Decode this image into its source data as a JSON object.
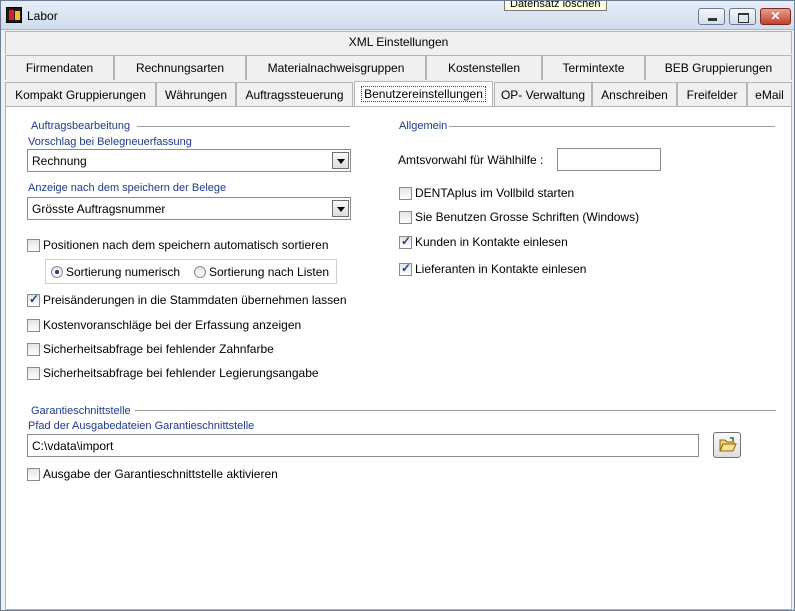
{
  "window": {
    "title": "Labor",
    "tooltip": "Datensatz löschen"
  },
  "tabs": {
    "row0": [
      "XML Einstellungen"
    ],
    "row1": [
      "Firmendaten",
      "Rechnungsarten",
      "Materialnachweisgruppen",
      "Kostenstellen",
      "Termintexte",
      "BEB Gruppierungen"
    ],
    "row2": [
      "Kompakt Gruppierungen",
      "Währungen",
      "Auftragssteuerung",
      "Benutzereinstellungen",
      "OP- Verwaltung",
      "Anschreiben",
      "Freifelder",
      "eMail"
    ],
    "active": "Benutzereinstellungen"
  },
  "auftragsbearbeitung": {
    "group_title": "Auftragsbearbeitung",
    "vorschlag_label": "Vorschlag bei Belegneuerfassung",
    "vorschlag_value": "Rechnung",
    "anzeige_label": "Anzeige nach dem speichern der Belege",
    "anzeige_value": "Grösste Auftragsnummer",
    "sort_auto": {
      "label": "Positionen nach dem speichern automatisch sortieren",
      "checked": false
    },
    "radio_numerisch": {
      "label": "Sortierung numerisch",
      "selected": true
    },
    "radio_listen": {
      "label": "Sortierung nach Listen",
      "selected": false
    },
    "preis": {
      "label": "Preisänderungen in die Stammdaten übernehmen lassen",
      "checked": true
    },
    "kosten": {
      "label": "Kostenvoranschläge bei der Erfassung anzeigen",
      "checked": false
    },
    "zahnfarbe": {
      "label": "Sicherheitsabfrage bei fehlender Zahnfarbe",
      "checked": false
    },
    "legierung": {
      "label": "Sicherheitsabfrage bei fehlender Legierungsangabe",
      "checked": false
    }
  },
  "allgemein": {
    "group_title": "Allgemein",
    "amtsvorwahl_label": "Amtsvorwahl für Wählhilfe :",
    "amtsvorwahl_value": "",
    "vollbild": {
      "label": "DENTAplus im Vollbild starten",
      "checked": false
    },
    "schriften": {
      "label": "Sie Benutzen Grosse Schriften (Windows)",
      "checked": false
    },
    "kunden": {
      "label": "Kunden in Kontakte einlesen",
      "checked": true
    },
    "lieferanten": {
      "label": "Lieferanten in Kontakte einlesen",
      "checked": true
    }
  },
  "garantie": {
    "group_title": "Garantieschnittstelle",
    "pfad_label": "Pfad der Ausgabedateien Garantieschnittstelle",
    "pfad_value": "C:\\vdata\\import",
    "aktivieren": {
      "label": "Ausgabe der Garantieschnittstelle aktivieren",
      "checked": false
    }
  },
  "icons": {
    "app": "app-icon",
    "folder": "folder-open-icon"
  }
}
